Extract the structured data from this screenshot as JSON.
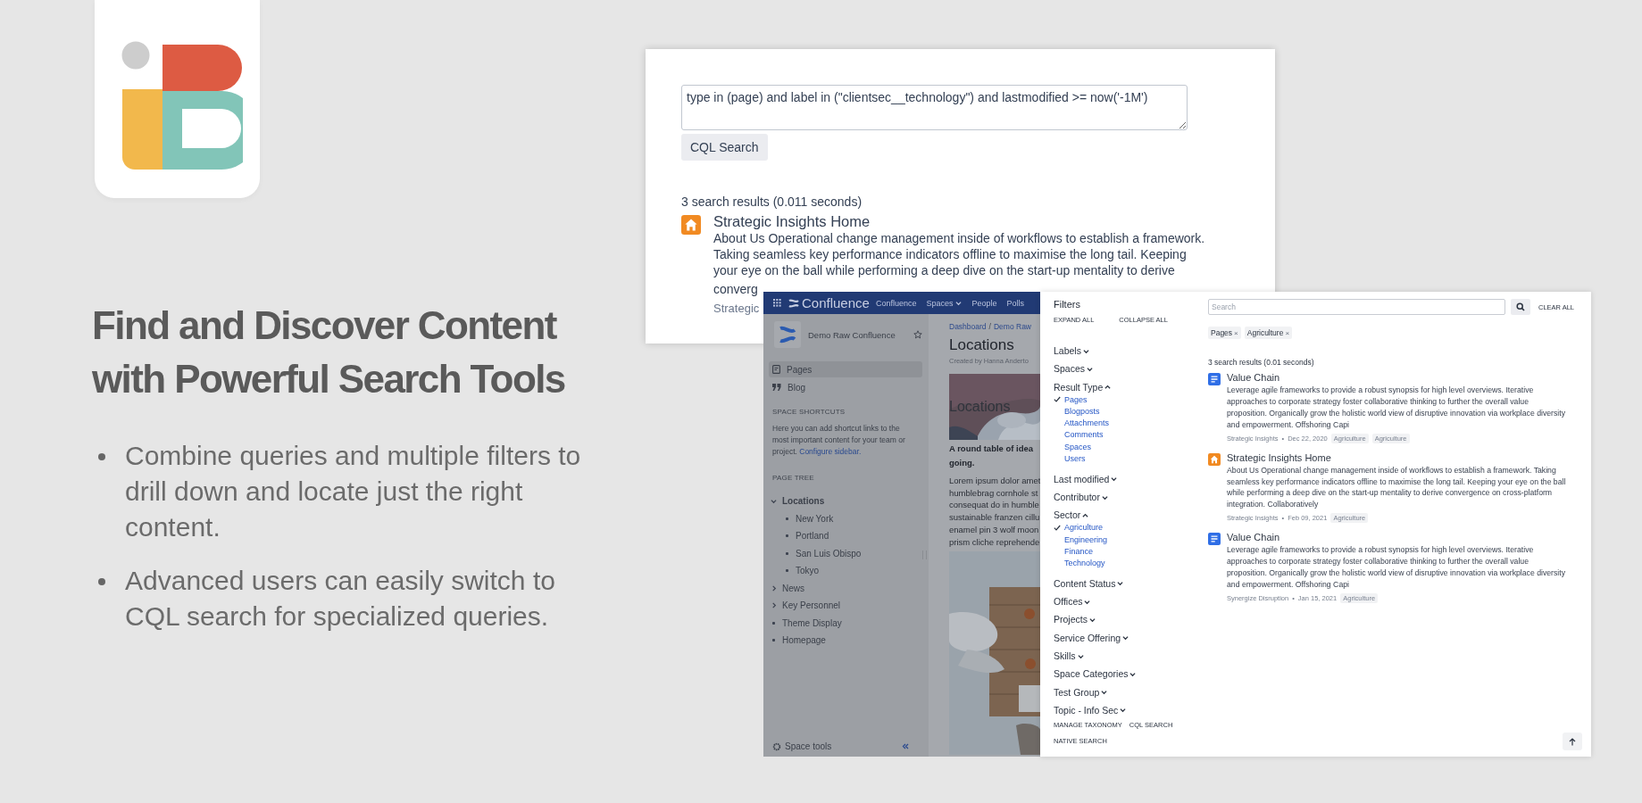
{
  "headline": [
    "Find and Discover Content",
    "with Powerful Search Tools"
  ],
  "bullets": [
    "Combine queries and multiple filters to drill down and locate just the right content.",
    "Advanced users can easily switch to CQL search for specialized queries."
  ],
  "cql_window": {
    "query": "type in (page) and label in (\"clientsec__technology\") and lastmodified >= now('-1M')",
    "button": "CQL Search",
    "summary": "3 search results (0.011 seconds)",
    "result": {
      "kind": "home",
      "title": "Strategic Insights Home",
      "description": "About Us Operational change management inside of workflows to establish a framework. Taking seamless key performance indicators offline to maximise the long tail. Keeping your eye on the ball while performing a deep dive on the start-up mentality to derive",
      "description_cut": "converg",
      "meta_cut": "Strategic"
    }
  },
  "confluence": {
    "nav": {
      "logo": "Confluence",
      "items": [
        {
          "label": "Confluence",
          "dropdown": false
        },
        {
          "label": "Spaces",
          "dropdown": true
        },
        {
          "label": "People",
          "dropdown": false
        },
        {
          "label": "Polls",
          "dropdown": false
        }
      ]
    },
    "space_name": "Demo Raw Confluence",
    "sidebar_items": [
      {
        "label": "Pages",
        "kind": "page",
        "selected": true
      },
      {
        "label": "Blog",
        "kind": "quote",
        "selected": false
      }
    ],
    "shortcuts": {
      "heading": "SPACE SHORTCUTS",
      "text": "Here you can add shortcut links to the most important content for your team or project.",
      "link": "Configure sidebar."
    },
    "page_tree": {
      "heading": "PAGE TREE",
      "items": [
        {
          "label": "Locations",
          "kind": "branch",
          "expanded": true,
          "children": [
            {
              "label": "New York",
              "kind": "leaf"
            },
            {
              "label": "Portland",
              "kind": "leaf"
            },
            {
              "label": "San Luis Obispo",
              "kind": "leaf"
            },
            {
              "label": "Tokyo",
              "kind": "leaf"
            }
          ]
        },
        {
          "label": "News",
          "kind": "branch",
          "expanded": false
        },
        {
          "label": "Key Personnel",
          "kind": "branch",
          "expanded": false
        },
        {
          "label": "Theme Display",
          "kind": "leaf"
        },
        {
          "label": "Homepage",
          "kind": "leaf"
        }
      ]
    },
    "space_tools": "Space tools",
    "page": {
      "breadcrumb": [
        "Dashboard",
        "Demo Raw"
      ],
      "breadcrumb_separator": "/",
      "title": "Locations",
      "byline": "Created by Hanna Anderto",
      "banner_title": "Locations",
      "intro": [
        "A round table of idea",
        "going."
      ],
      "body_lines": [
        "Lorem ipsum dolor amet",
        "humblebrag cornhole st",
        "consequat do in humble",
        "sustainable franzen cillu",
        "enamel pin 3 wolf moon",
        "prism cliche reprehende"
      ]
    }
  },
  "filters": {
    "title": "Filters",
    "expand_all": "EXPAND ALL",
    "collapse_all": "COLLAPSE ALL",
    "groups": [
      {
        "label": "Labels",
        "expanded": false
      },
      {
        "label": "Spaces",
        "expanded": false
      },
      {
        "label": "Result Type",
        "expanded": true,
        "options": [
          {
            "label": "Pages",
            "checked": true
          },
          {
            "label": "Blogposts",
            "checked": false
          },
          {
            "label": "Attachments",
            "checked": false
          },
          {
            "label": "Comments",
            "checked": false
          },
          {
            "label": "Spaces",
            "checked": false
          },
          {
            "label": "Users",
            "checked": false
          }
        ]
      },
      {
        "label": "Last modified",
        "expanded": false
      },
      {
        "label": "Contributor",
        "expanded": false
      },
      {
        "label": "Sector",
        "expanded": true,
        "options": [
          {
            "label": "Agriculture",
            "checked": true
          },
          {
            "label": "Engineering",
            "checked": false
          },
          {
            "label": "Finance",
            "checked": false
          },
          {
            "label": "Technology",
            "checked": false
          }
        ]
      },
      {
        "label": "Content Status",
        "expanded": false
      },
      {
        "label": "Offices",
        "expanded": false
      },
      {
        "label": "Projects",
        "expanded": false
      },
      {
        "label": "Service Offering",
        "expanded": false
      },
      {
        "label": "Skills",
        "expanded": false
      },
      {
        "label": "Space Categories",
        "expanded": false
      },
      {
        "label": "Test Group",
        "expanded": false
      },
      {
        "label": "Topic - Info Sec",
        "expanded": false
      }
    ],
    "footer_links": [
      "MANAGE TAXONOMY",
      "CQL SEARCH",
      "NATIVE SEARCH"
    ]
  },
  "results": {
    "search_placeholder": "Search",
    "clear_all": "CLEAR ALL",
    "chips": [
      {
        "label": "Pages",
        "remove": "×"
      },
      {
        "label": "Agriculture",
        "remove": "×"
      }
    ],
    "summary": "3 search results (0.01 seconds)",
    "items": [
      {
        "kind": "page",
        "title": "Value Chain",
        "description": "Leverage agile frameworks to provide a robust synopsis for high level overviews. Iterative approaches to corporate strategy foster collaborative thinking to further the overall value proposition. Organically grow the holistic world view of disruptive innovation via workplace diversity and empowerment. Offshoring Capi",
        "space": "Strategic Insights",
        "separator": "•",
        "date": "Dec 22, 2020",
        "labels": [
          "Agriculture",
          "Agriculture"
        ]
      },
      {
        "kind": "home",
        "title": "Strategic Insights Home",
        "description": "About Us Operational change management inside of workflows to establish a framework. Taking seamless key performance indicators offline to maximise the long tail. Keeping your eye on the ball while performing a deep dive on the start-up mentality to derive convergence on cross-platform integration. Collaboratively",
        "space": "Strategic Insights",
        "separator": "•",
        "date": "Feb 09, 2021",
        "labels": [
          "Agriculture"
        ]
      },
      {
        "kind": "page",
        "title": "Value Chain",
        "description": "Leverage agile frameworks to provide a robust synopsis for high level overviews. Iterative approaches to corporate strategy foster collaborative thinking to further the overall value proposition. Organically grow the holistic world view of disruptive innovation via workplace diversity and empowerment. Offshoring Capi",
        "space": "Synergize Disruption",
        "separator": "•",
        "date": "Jan 15, 2021",
        "labels": [
          "Agriculture"
        ]
      }
    ]
  }
}
